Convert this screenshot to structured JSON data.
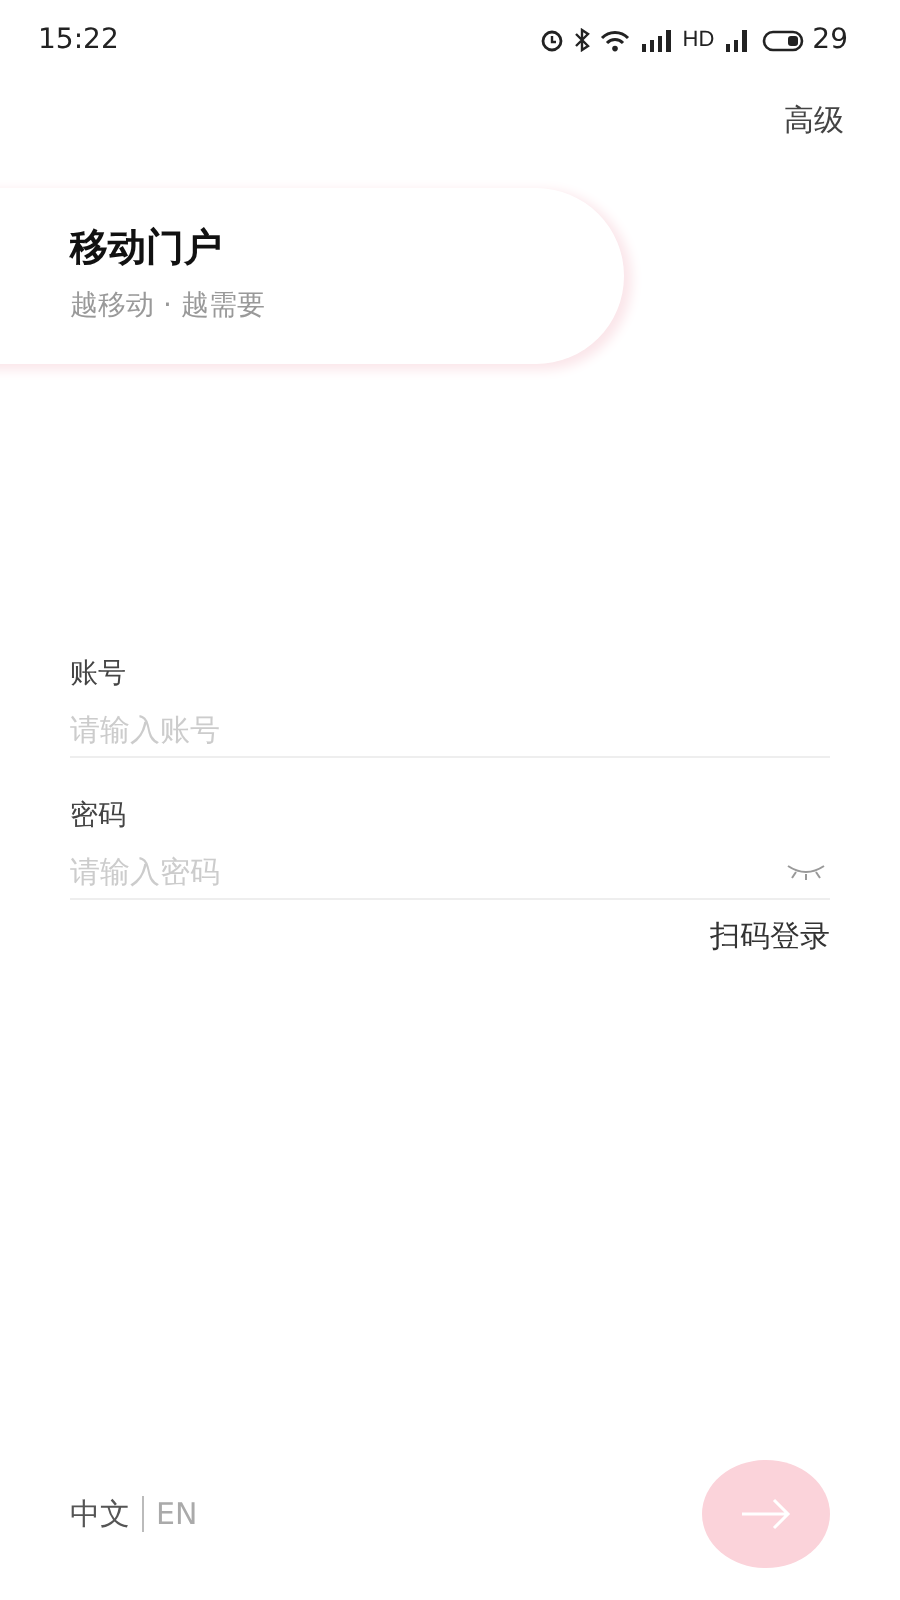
{
  "status_bar": {
    "time": "15:22",
    "network": "HD",
    "battery": "29"
  },
  "advanced_link": "高级",
  "header": {
    "title": "移动门户",
    "subtitle": "越移动 · 越需要"
  },
  "fields": [
    {
      "label": "账号",
      "placeholder": "请输入账号",
      "kind": "text"
    },
    {
      "label": "密码",
      "placeholder": "请输入密码",
      "kind": "password"
    }
  ],
  "scan_login": "扫码登录",
  "languages": [
    {
      "label": "中文",
      "selected": true
    },
    {
      "label": "EN",
      "selected": false
    }
  ],
  "login_button": {
    "disabled": true
  }
}
